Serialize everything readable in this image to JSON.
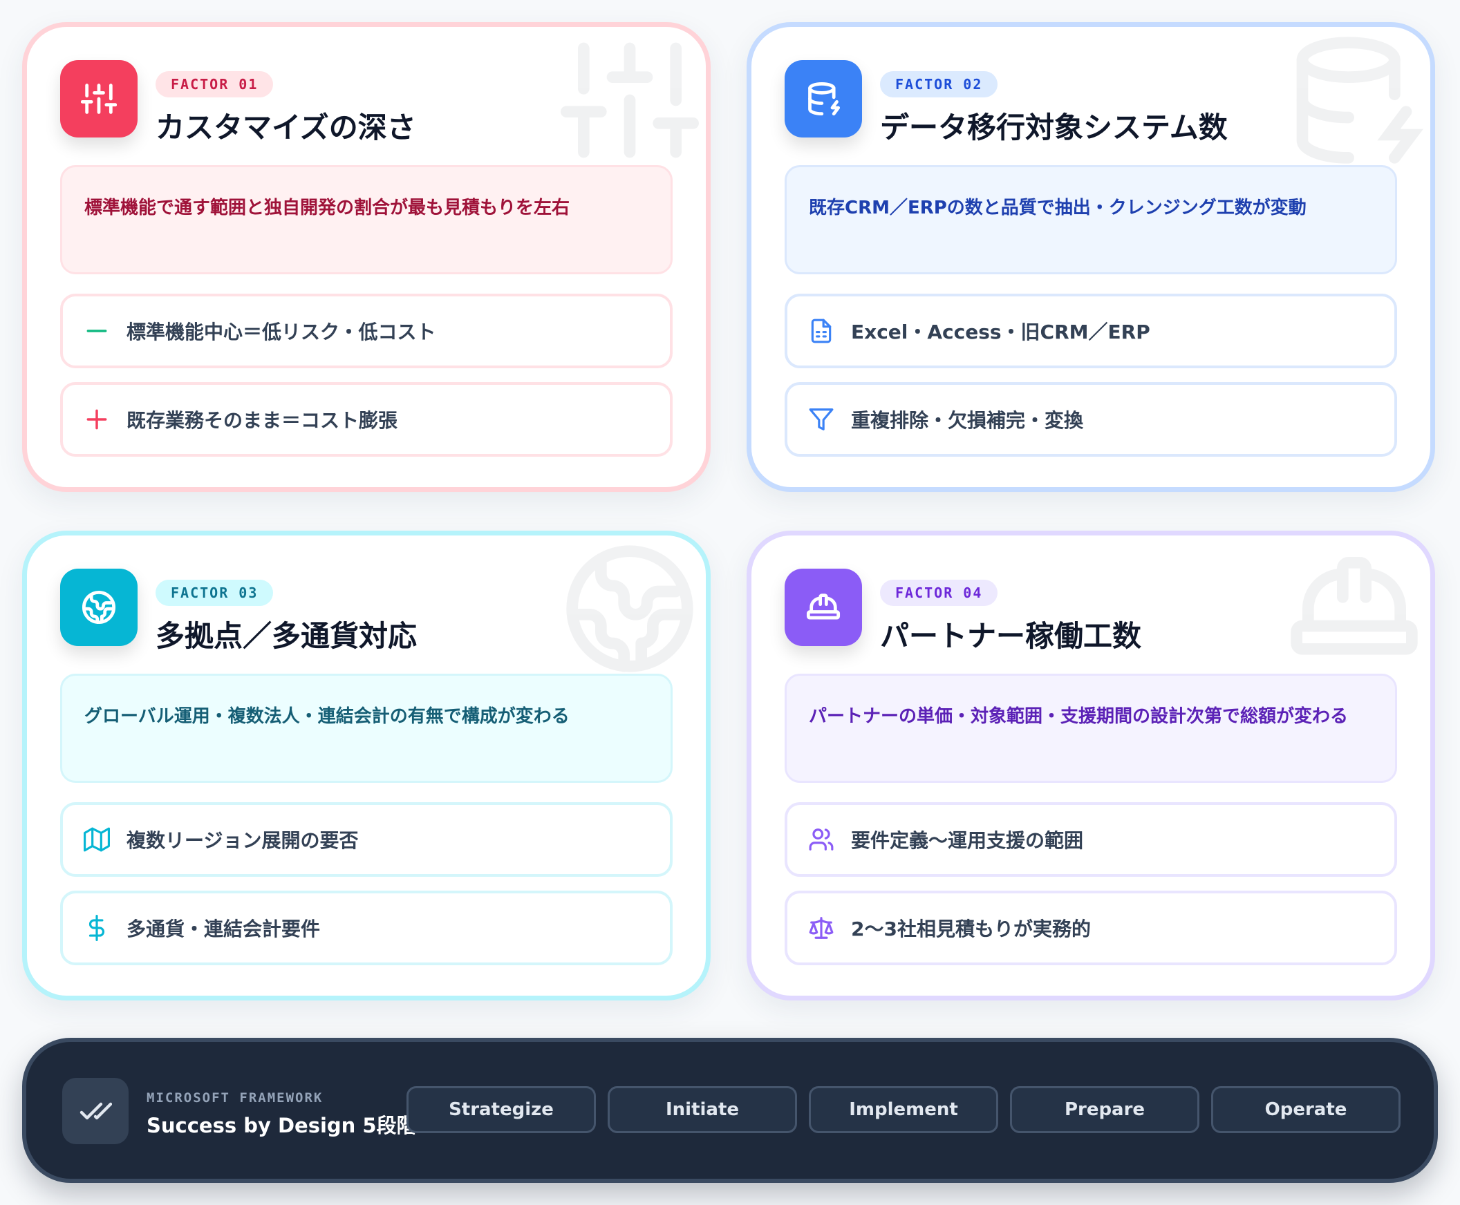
{
  "factors": [
    {
      "label": "FACTOR 01",
      "title": "カスタマイズの深さ",
      "icon": "sliders-icon",
      "color": "#f43f5e",
      "summary": "標準機能で通す範囲と独自開発の割合が最も見積もりを左右",
      "items": [
        {
          "icon": "minus-icon",
          "text": "標準機能中心＝低リスク・低コスト"
        },
        {
          "icon": "plus-icon",
          "text": "既存業務そのまま＝コスト膨張"
        }
      ]
    },
    {
      "label": "FACTOR 02",
      "title": "データ移行対象システム数",
      "icon": "database-icon",
      "color": "#3b82f6",
      "summary": "既存CRM／ERPの数と品質で抽出・クレンジング工数が変動",
      "items": [
        {
          "icon": "spreadsheet-icon",
          "text": "Excel・Access・旧CRM／ERP"
        },
        {
          "icon": "filter-icon",
          "text": "重複排除・欠損補完・変換"
        }
      ]
    },
    {
      "label": "FACTOR 03",
      "title": "多拠点／多通貨対応",
      "icon": "globe-icon",
      "color": "#06b6d4",
      "summary": "グローバル運用・複数法人・連結会計の有無で構成が変わる",
      "items": [
        {
          "icon": "map-icon",
          "text": "複数リージョン展開の要否"
        },
        {
          "icon": "dollar-icon",
          "text": "多通貨・連結会計要件"
        }
      ]
    },
    {
      "label": "FACTOR 04",
      "title": "パートナー稼働工数",
      "icon": "hard-hat-icon",
      "color": "#8b5cf6",
      "summary": "パートナーの単価・対象範囲・支援期間の設計次第で総額が変わる",
      "items": [
        {
          "icon": "users-icon",
          "text": "要件定義〜運用支援の範囲"
        },
        {
          "icon": "scale-icon",
          "text": "2〜3社相見積もりが実務的"
        }
      ]
    }
  ],
  "framework": {
    "kicker": "MICROSOFT FRAMEWORK",
    "title": "Success by Design 5段階",
    "icon": "double-check-icon",
    "stages": [
      "Strategize",
      "Initiate",
      "Implement",
      "Prepare",
      "Operate"
    ]
  }
}
